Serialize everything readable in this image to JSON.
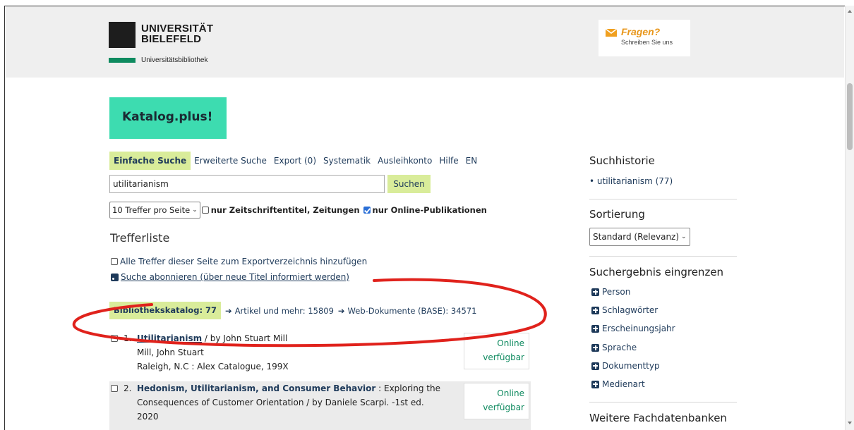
{
  "header": {
    "university_line1": "UNIVERSITÄT",
    "university_line2": "BIELEFELD",
    "library": "Universitätsbibliothek",
    "fragen_title": "Fragen?",
    "fragen_sub": "Schreiben Sie uns"
  },
  "catalog": {
    "title": "Katalog.plus!"
  },
  "nav": {
    "tabs": [
      "Einfache Suche",
      "Erweiterte Suche",
      "Export (0)",
      "Systematik",
      "Ausleihkonto",
      "Hilfe",
      "EN"
    ]
  },
  "search": {
    "value": "utilitarianism",
    "button": "Suchen"
  },
  "options": {
    "per_page": "10 Treffer pro Seite",
    "journals_label": "nur Zeitschriftentitel, Zeitungen",
    "online_label": "nur Online-Publikationen"
  },
  "results": {
    "heading": "Trefferliste",
    "add_all": "Alle Treffer dieser Seite zum Exportverzeichnis hinzufügen",
    "subscribe": "Suche abonnieren (über neue Titel informiert werden)",
    "tabs": {
      "katalog": "Bibliothekskatalog: 77",
      "artikel": "Artikel und mehr: 15809",
      "web": "Web-Dokumente (BASE): 34571"
    },
    "items": [
      {
        "num": "1.",
        "title": "Utilitarianism",
        "rest": " / by John Stuart Mill",
        "line2": "Mill, John Stuart",
        "line3": "Raleigh, N.C : Alex Catalogue, 199X",
        "online1": "Online",
        "online2": "verfügbar"
      },
      {
        "num": "2.",
        "title": "Hedonism, Utilitarianism, and Consumer Behavior",
        "rest": " : Exploring the",
        "line2": "Consequences of Customer Orientation / by Daniele Scarpi. -1st ed.",
        "line3": "2020",
        "online1": "Online",
        "online2": "verfügbar"
      }
    ]
  },
  "sidebar": {
    "history_heading": "Suchhistorie",
    "history_item": "utilitarianism (77)",
    "sort_heading": "Sortierung",
    "sort_value": "Standard (Relevanz)",
    "refine_heading": "Suchergebnis eingrenzen",
    "facets": [
      "Person",
      "Schlagwörter",
      "Erscheinungsjahr",
      "Sprache",
      "Dokumenttyp",
      "Medienart"
    ],
    "more_heading": "Weitere Fachdatenbanken"
  },
  "colors": {
    "accent_green": "#3ddcb0",
    "highlight": "#d9ec9a",
    "link": "#1e3a5a",
    "online": "#0e8a5f",
    "annotation_red": "#e0221c"
  }
}
